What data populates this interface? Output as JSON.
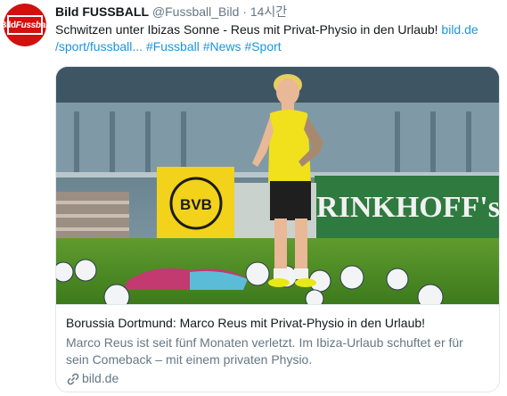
{
  "tweet": {
    "avatar_text": [
      "Bild",
      "Fussball"
    ],
    "display_name": "Bild FUSSBALL",
    "handle": "@Fussball_Bild",
    "separator": "·",
    "time": "14시간",
    "text_plain": "Schwitzen unter Ibizas Sonne - Reus mit Privat-Physio in den Urlaub! ",
    "text_link_1": "bild.de",
    "text_link_2": "/sport/fussball...",
    "hashtags": [
      "#Fussball",
      "#News",
      "#Sport"
    ],
    "card": {
      "image_icon": "training-photo",
      "title": "Borussia Dortmund: Marco Reus mit Privat-Physio in den Urlaub!",
      "description_line1": "Marco Reus ist seit fünf Monaten verletzt. Im Ibiza-Urlaub schuftet er für",
      "description_line2": "sein Comeback – mit einem privaten Physio.",
      "domain_icon": "link-icon",
      "domain": "bild.de"
    }
  },
  "colors": {
    "text": "#14171a",
    "secondary": "#657786",
    "link": "#1b95e0",
    "border": "#e1e8ed",
    "brand_red": "#d21010"
  }
}
